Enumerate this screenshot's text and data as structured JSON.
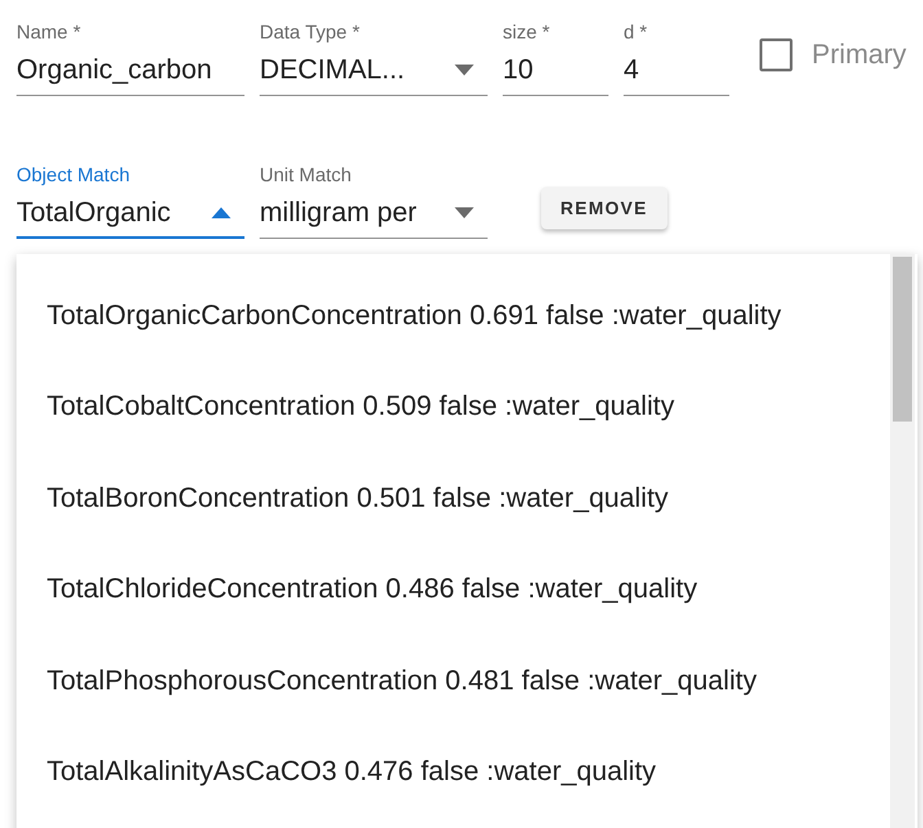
{
  "row_1": {
    "fields": [
      {
        "kind": "text",
        "label": "Name *",
        "value": "Organic_carbon"
      },
      {
        "kind": "select",
        "label": "Data Type *",
        "value": "DECIMAL..."
      },
      {
        "kind": "narrow",
        "label": "size *",
        "value": "10"
      },
      {
        "kind": "narrow",
        "label": "d *",
        "value": "4"
      }
    ],
    "checkbox": {
      "label": "Primary",
      "checked": false
    }
  },
  "row_2": {
    "fields": [
      {
        "kind": "select",
        "label": "Object Match",
        "value": "TotalOrganic",
        "focused": true,
        "expanded": true
      },
      {
        "kind": "select",
        "label": "Unit Match",
        "value": "milligram per",
        "focused": false,
        "expanded": false
      }
    ],
    "button": "REMOVE"
  },
  "dropdown": {
    "options": [
      {
        "label": "TotalOrganicCarbonConcentration 0.691 false :water_quality"
      },
      {
        "label": "TotalCobaltConcentration 0.509 false :water_quality"
      },
      {
        "label": "TotalBoronConcentration 0.501 false :water_quality"
      },
      {
        "label": "TotalChlorideConcentration 0.486 false :water_quality"
      },
      {
        "label": "TotalPhosphorousConcentration 0.481 false :water_quality"
      },
      {
        "label": "TotalAlkalinityAsCaCO3 0.476 false :water_quality"
      }
    ]
  }
}
